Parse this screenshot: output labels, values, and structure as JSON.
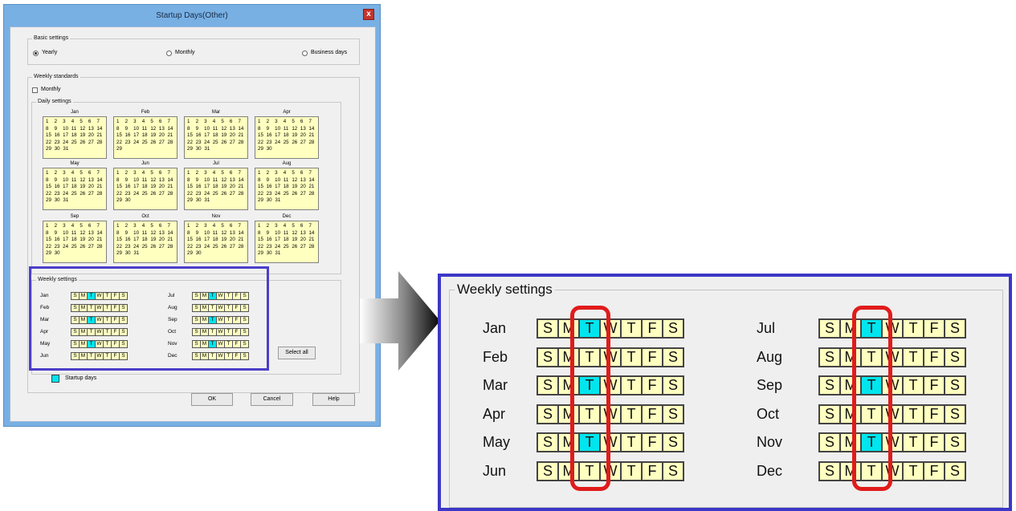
{
  "dialog": {
    "title": "Startup Days(Other)",
    "close_glyph": "x",
    "basic_settings": {
      "legend": "Basic settings",
      "options": [
        {
          "label": "Yearly",
          "checked": true
        },
        {
          "label": "Monthly",
          "checked": false
        },
        {
          "label": "Business days",
          "checked": false
        }
      ]
    },
    "weekly_standards": {
      "legend": "Weekly standards",
      "monthly_checkbox": "Monthly"
    },
    "daily_settings": {
      "legend": "Daily settings",
      "months": [
        {
          "name": "Jan",
          "days": 31
        },
        {
          "name": "Feb",
          "days": 29
        },
        {
          "name": "Mar",
          "days": 31
        },
        {
          "name": "Apr",
          "days": 30
        },
        {
          "name": "May",
          "days": 31
        },
        {
          "name": "Jun",
          "days": 30
        },
        {
          "name": "Jul",
          "days": 31
        },
        {
          "name": "Aug",
          "days": 31
        },
        {
          "name": "Sep",
          "days": 30
        },
        {
          "name": "Oct",
          "days": 31
        },
        {
          "name": "Nov",
          "days": 30
        },
        {
          "name": "Dec",
          "days": 31
        }
      ]
    },
    "weekly_settings": {
      "legend": "Weekly settings",
      "weekday_letters": [
        "S",
        "M",
        "T",
        "W",
        "T",
        "F",
        "S"
      ],
      "rows": [
        {
          "month": "Jan",
          "highlight": 2
        },
        {
          "month": "Feb",
          "highlight": -1
        },
        {
          "month": "Mar",
          "highlight": 2
        },
        {
          "month": "Apr",
          "highlight": -1
        },
        {
          "month": "May",
          "highlight": 2
        },
        {
          "month": "Jun",
          "highlight": -1
        },
        {
          "month": "Jul",
          "highlight": 2
        },
        {
          "month": "Aug",
          "highlight": -1
        },
        {
          "month": "Sep",
          "highlight": 2
        },
        {
          "month": "Oct",
          "highlight": -1
        },
        {
          "month": "Nov",
          "highlight": 2
        },
        {
          "month": "Dec",
          "highlight": -1
        }
      ],
      "select_all_label": "Select all"
    },
    "legend_startup_days": "Startup days",
    "buttons": {
      "ok": "OK",
      "cancel": "Cancel",
      "help": "Help"
    }
  },
  "zoom_panel": {
    "legend": "Weekly settings"
  },
  "colors": {
    "calendar_bg": "#ffffc0",
    "startup_day": "#00e5ee",
    "focus_box": "#4b3fc8",
    "callout": "#e11b1b"
  }
}
